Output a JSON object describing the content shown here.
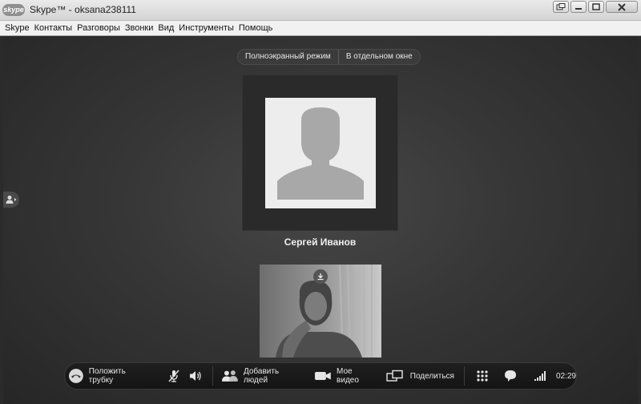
{
  "window": {
    "logo_text": "skype",
    "title": "Skype™ - oksana238111",
    "controls": [
      "restore-down",
      "minimize",
      "maximize",
      "close"
    ]
  },
  "menu": {
    "items": [
      "Skype",
      "Контакты",
      "Разговоры",
      "Звонки",
      "Вид",
      "Инструменты",
      "Помощь"
    ]
  },
  "call": {
    "view_modes": {
      "fullscreen_label": "Полноэкранный режим",
      "separate_window_label": "В отдельном окне"
    },
    "contact": {
      "name": "Сергей Иванов",
      "avatar_icon": "default-person-silhouette"
    },
    "self_video": {
      "download_icon": "download-icon"
    },
    "side_tab_icon": "contact-panel-arrow-icon"
  },
  "controls": {
    "hang_up_label": "Положить трубку",
    "add_people_label": "Добавить людей",
    "my_video_label": "Мое видео",
    "share_label": "Поделиться",
    "call_duration": "02:29",
    "icons": [
      "hang-up-icon",
      "mute-mic-icon",
      "speaker-icon",
      "add-people-icon",
      "video-camera-icon",
      "share-screen-icon",
      "dialpad-icon",
      "chat-bubble-icon",
      "signal-strength-icon"
    ]
  },
  "colors": {
    "hang_up_button": "#d9d9d9",
    "call_background": "#363636",
    "control_bar": "#181818"
  }
}
